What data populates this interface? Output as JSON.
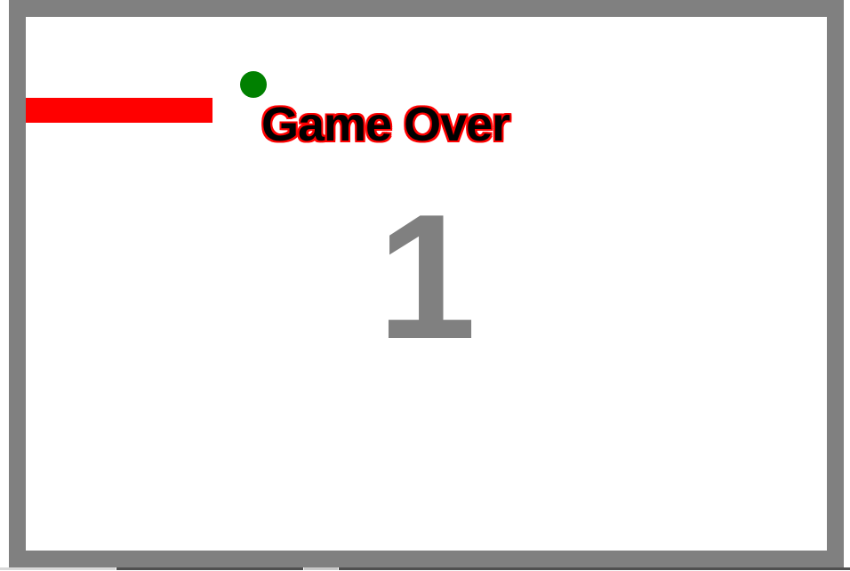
{
  "game": {
    "title": "Game Over",
    "score": "1"
  },
  "colors": {
    "wall": "#808080",
    "background": "#ffffff",
    "snake": "#ff0000",
    "food": "#008000",
    "title_fill": "#000000",
    "title_outline": "#ff0000",
    "score": "#808080"
  }
}
